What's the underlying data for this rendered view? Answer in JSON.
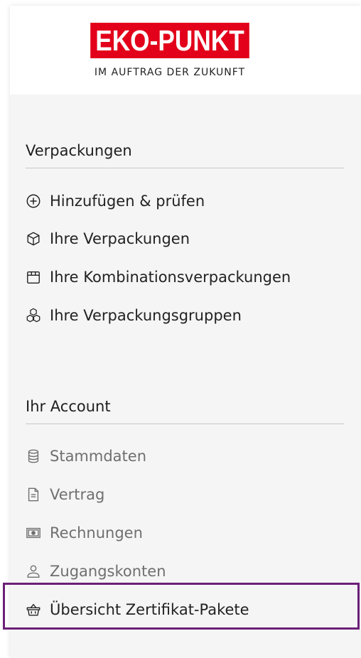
{
  "logo": {
    "brand": "EKO-PUNKT",
    "tagline": "IM AUFTRAG DER ZUKUNFT",
    "color": "#e2001a"
  },
  "sections": {
    "packaging": {
      "title": "Verpackungen",
      "items": [
        {
          "label": "Hinzufügen & prüfen",
          "icon": "plus-circle-icon"
        },
        {
          "label": "Ihre Verpackungen",
          "icon": "box-icon"
        },
        {
          "label": "Ihre Kombinationsverpackungen",
          "icon": "package-icon"
        },
        {
          "label": "Ihre Verpackungsgruppen",
          "icon": "boxes-icon"
        }
      ]
    },
    "account": {
      "title": "Ihr Account",
      "items": [
        {
          "label": "Stammdaten",
          "icon": "database-icon"
        },
        {
          "label": "Vertrag",
          "icon": "document-icon"
        },
        {
          "label": "Rechnungen",
          "icon": "money-icon"
        },
        {
          "label": "Zugangskonten",
          "icon": "user-icon"
        },
        {
          "label": "Übersicht Zertifikat-Pakete",
          "icon": "basket-icon"
        }
      ]
    }
  },
  "highlight_color": "#6b2077"
}
